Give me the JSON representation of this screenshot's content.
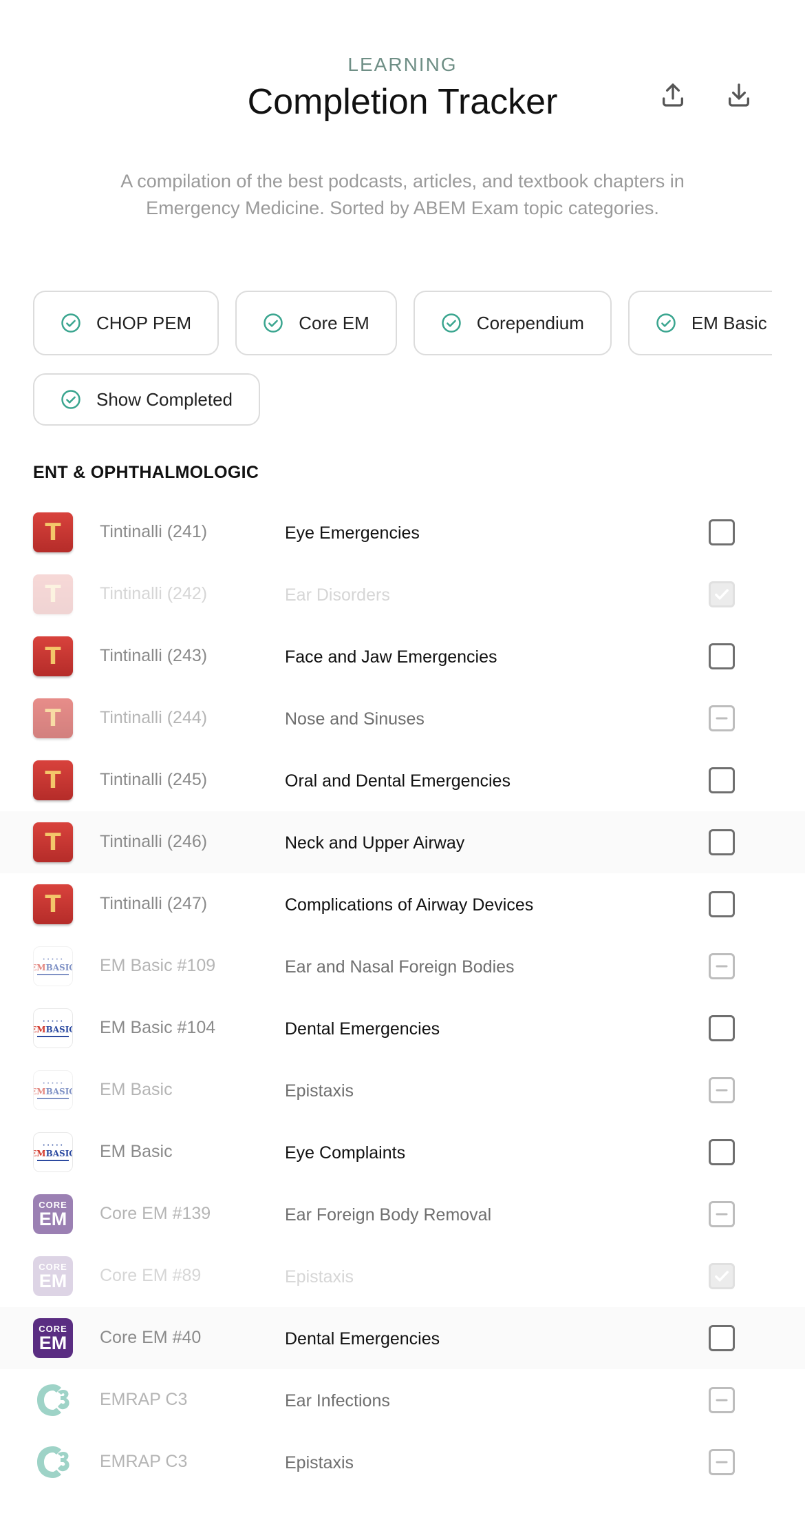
{
  "header": {
    "eyebrow": "LEARNING",
    "title": "Completion Tracker",
    "upload_icon": "upload-icon",
    "download_icon": "download-icon"
  },
  "description": "A compilation of the best podcasts, articles, and textbook chapters in Emergency Medicine. Sorted by ABEM Exam topic categories.",
  "filters": [
    {
      "label": "CHOP PEM",
      "checked": true
    },
    {
      "label": "Core EM",
      "checked": true
    },
    {
      "label": "Corependium",
      "checked": true
    },
    {
      "label": "EM Basic",
      "checked": true
    }
  ],
  "show_completed": {
    "label": "Show Completed",
    "checked": true
  },
  "section": {
    "title": "ENT & OPHTHALMOLOGIC"
  },
  "items": [
    {
      "logo": "tintinalli",
      "source": "Tintinalli (241)",
      "title": "Eye Emergencies",
      "state": "unchecked"
    },
    {
      "logo": "tintinalli",
      "source": "Tintinalli (242)",
      "title": "Ear Disorders",
      "state": "checked"
    },
    {
      "logo": "tintinalli",
      "source": "Tintinalli (243)",
      "title": "Face and Jaw Emergencies",
      "state": "unchecked"
    },
    {
      "logo": "tintinalli",
      "source": "Tintinalli (244)",
      "title": "Nose and Sinuses",
      "state": "partial"
    },
    {
      "logo": "tintinalli",
      "source": "Tintinalli (245)",
      "title": "Oral and Dental Emergencies",
      "state": "unchecked"
    },
    {
      "logo": "tintinalli",
      "source": "Tintinalli (246)",
      "title": "Neck and Upper Airway",
      "state": "unchecked"
    },
    {
      "logo": "tintinalli",
      "source": "Tintinalli (247)",
      "title": "Complications of Airway Devices",
      "state": "unchecked"
    },
    {
      "logo": "embasic",
      "source": "EM Basic #109",
      "title": "Ear and Nasal Foreign Bodies",
      "state": "partial"
    },
    {
      "logo": "embasic",
      "source": "EM Basic #104",
      "title": "Dental Emergencies",
      "state": "unchecked"
    },
    {
      "logo": "embasic",
      "source": "EM Basic",
      "title": "Epistaxis",
      "state": "partial"
    },
    {
      "logo": "embasic",
      "source": "EM Basic",
      "title": "Eye Complaints",
      "state": "unchecked"
    },
    {
      "logo": "coreem",
      "source": "Core EM #139",
      "title": "Ear Foreign Body Removal",
      "state": "partial"
    },
    {
      "logo": "coreem",
      "source": "Core EM #89",
      "title": "Epistaxis",
      "state": "checked"
    },
    {
      "logo": "coreem",
      "source": "Core EM #40",
      "title": "Dental Emergencies",
      "state": "unchecked"
    },
    {
      "logo": "emrapc3",
      "source": "EMRAP C3",
      "title": "Ear Infections",
      "state": "partial"
    },
    {
      "logo": "emrapc3",
      "source": "EMRAP C3",
      "title": "Epistaxis",
      "state": "partial"
    }
  ],
  "logo_text": {
    "tintinalli": "T",
    "embasic_em": "EM",
    "embasic_basic": "BASIC",
    "embasic_dots": "• • • • •",
    "coreem_top": "CORE",
    "coreem_bottom": "EM"
  },
  "colors": {
    "accent_check": "#3aa58f",
    "eyebrow": "#6f8f86",
    "tintinalli_red": "#c63632",
    "coreem_purple": "#5a2d82",
    "emrap_teal": "#5fb7a3"
  }
}
